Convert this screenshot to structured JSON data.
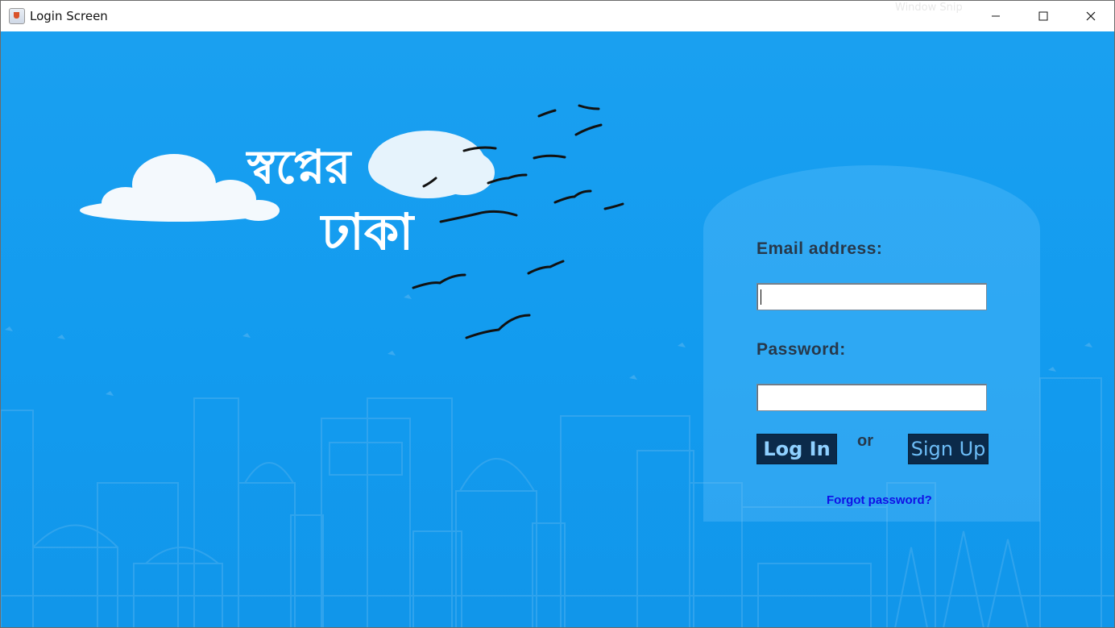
{
  "window": {
    "title": "Login Screen",
    "controls": {
      "minimize": "—",
      "maximize": "☐",
      "close": "✕"
    },
    "background_overlay_text": "Window Snip"
  },
  "logo": {
    "line1": "স্বপ্নের",
    "line2": "ঢাকা"
  },
  "form": {
    "email_label": "Email address:",
    "email_value": "",
    "password_label": "Password:",
    "password_value": "",
    "login_button": "Log In",
    "or_text": "or",
    "signup_button": "Sign Up",
    "forgot_link": "Forgot password?"
  },
  "colors": {
    "background": "#1aa0f0",
    "button_bg": "#0b2a4a",
    "label": "#27384a",
    "link": "#1010e6"
  }
}
